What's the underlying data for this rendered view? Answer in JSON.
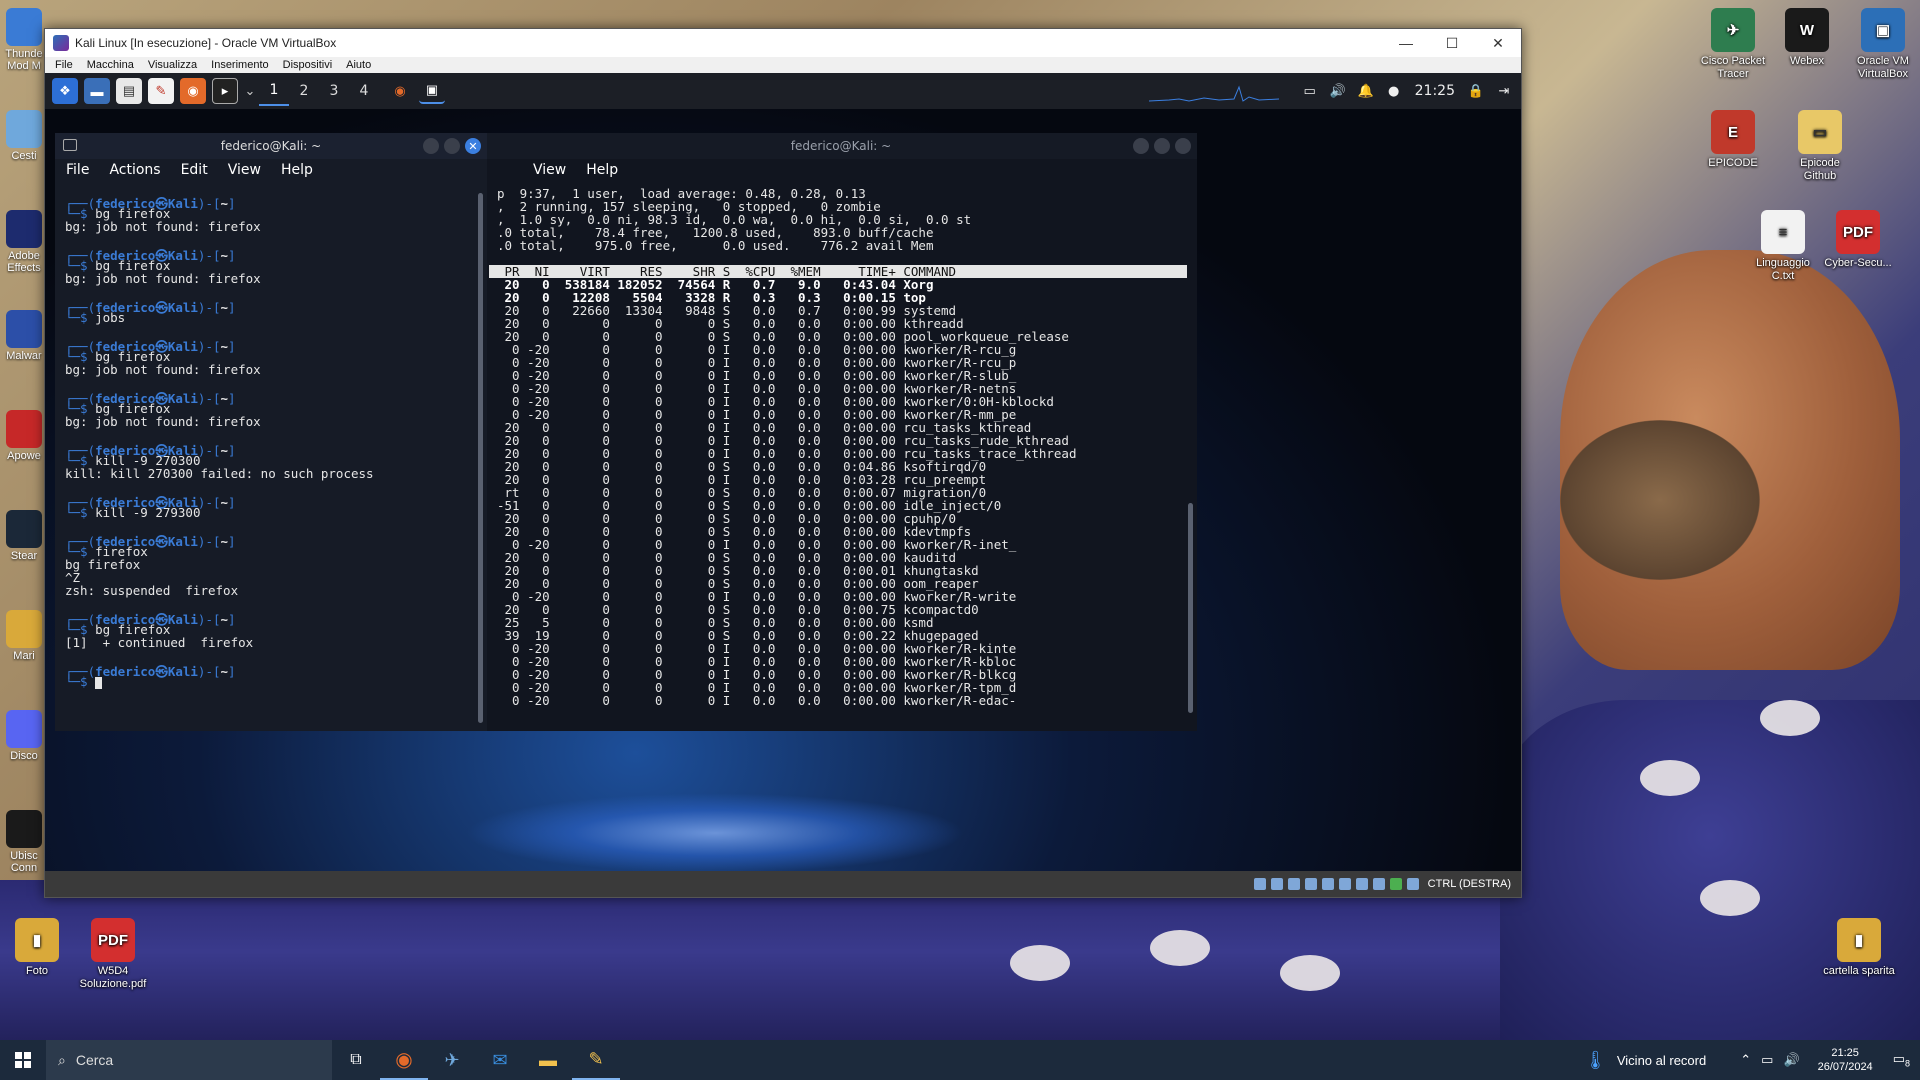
{
  "desktop": {
    "right_icons": [
      {
        "label": "Cisco Packet Tracer",
        "color": "#2e7d4f",
        "glyph": "✈"
      },
      {
        "label": "Webex",
        "color": "#1a1a1a",
        "glyph": "W"
      },
      {
        "label": "Oracle VM VirtualBox",
        "color": "#2c6fb7",
        "glyph": "▣"
      },
      {
        "label": "EPICODE",
        "color": "#c0392b",
        "glyph": "E"
      },
      {
        "label": "Epicode Github",
        "color": "#e8c867",
        "glyph": "▭"
      },
      {
        "label": "Linguaggio C.txt",
        "color": "#f2f2f2",
        "glyph": "≡"
      },
      {
        "label": "Cyber-Secu...",
        "color": "#d32f2f",
        "glyph": "PDF"
      },
      {
        "label": "cartella sparita",
        "color": "#d9a93a",
        "glyph": "▮"
      }
    ],
    "bottom_icons": [
      {
        "label": "Foto",
        "color": "#d9a93a",
        "glyph": "▮"
      },
      {
        "label": "W5D4 Soluzione.pdf",
        "color": "#d32f2f",
        "glyph": "PDF"
      }
    ],
    "left_partial_icons": [
      {
        "label": "Thunde Mod M",
        "color": "#3a7bd5"
      },
      {
        "label": "Cesti",
        "color": "#6fa8dc"
      },
      {
        "label": "Adobe Effects",
        "color": "#1d2b6e"
      },
      {
        "label": "Malwar",
        "color": "#2c4fa8"
      },
      {
        "label": "Apowe",
        "color": "#c62828"
      },
      {
        "label": "Stear",
        "color": "#1b2838"
      },
      {
        "label": "Mari",
        "color": "#d9a93a"
      },
      {
        "label": "Disco",
        "color": "#5865f2"
      },
      {
        "label": "Ubisc Conn",
        "color": "#1a1a1a"
      }
    ]
  },
  "vbox": {
    "title": "Kali Linux [In esecuzione] - Oracle VM VirtualBox",
    "menu": [
      "File",
      "Macchina",
      "Visualizza",
      "Inserimento",
      "Dispositivi",
      "Aiuto"
    ],
    "status_text": "CTRL (DESTRA)"
  },
  "kali_panel": {
    "workspaces": [
      "1",
      "2",
      "3",
      "4"
    ],
    "clock": "21:25"
  },
  "term_left": {
    "title": "federico@Kali: ~",
    "menu": [
      "File",
      "Actions",
      "Edit",
      "View",
      "Help"
    ],
    "prompt_user": "federico㉿Kali",
    "prompt_dir": "~",
    "blocks": [
      {
        "cmd": "bg firefox",
        "out": [
          "bg: job not found: firefox"
        ]
      },
      {
        "cmd": "bg firefox",
        "out": [
          "bg: job not found: firefox"
        ]
      },
      {
        "cmd": "jobs",
        "out": []
      },
      {
        "cmd": "bg firefox",
        "out": [
          "bg: job not found: firefox"
        ]
      },
      {
        "cmd": "bg firefox",
        "out": [
          "bg: job not found: firefox"
        ]
      },
      {
        "cmd": "kill -9 270300",
        "out": [
          "kill: kill 270300 failed: no such process"
        ]
      },
      {
        "cmd": "kill -9 279300",
        "out": []
      },
      {
        "cmd": "firefox",
        "out": [
          "bg firefox",
          "^Z",
          "zsh: suspended  firefox"
        ]
      },
      {
        "cmd": "bg firefox",
        "out": [
          "[1]  + continued  firefox"
        ]
      }
    ]
  },
  "term_right": {
    "title": "federico@Kali: ~",
    "menu": [
      "View",
      "Help"
    ],
    "summary": [
      "p  9:37,  1 user,  load average: 0.48, 0.28, 0.13",
      ",  2 running, 157 sleeping,   0 stopped,   0 zombie",
      ",  1.0 sy,  0.0 ni, 98.3 id,  0.0 wa,  0.0 hi,  0.0 si,  0.0 st",
      ".0 total,    78.4 free,   1200.8 used,    893.0 buff/cache",
      ".0 total,    975.0 free,      0.0 used.    776.2 avail Mem"
    ],
    "header": " PR  NI    VIRT    RES    SHR S  %CPU  %MEM     TIME+ COMMAND",
    "rows": [
      " 20   0  538184 182052  74564 R   0.7   9.0   0:43.04 Xorg",
      " 20   0   12208   5504   3328 R   0.3   0.3   0:00.15 top",
      " 20   0   22660  13304   9848 S   0.0   0.7   0:00.99 systemd",
      " 20   0       0      0      0 S   0.0   0.0   0:00.00 kthreadd",
      " 20   0       0      0      0 S   0.0   0.0   0:00.00 pool_workqueue_release",
      "  0 -20       0      0      0 I   0.0   0.0   0:00.00 kworker/R-rcu_g",
      "  0 -20       0      0      0 I   0.0   0.0   0:00.00 kworker/R-rcu_p",
      "  0 -20       0      0      0 I   0.0   0.0   0:00.00 kworker/R-slub_",
      "  0 -20       0      0      0 I   0.0   0.0   0:00.00 kworker/R-netns",
      "  0 -20       0      0      0 I   0.0   0.0   0:00.00 kworker/0:0H-kblockd",
      "  0 -20       0      0      0 I   0.0   0.0   0:00.00 kworker/R-mm_pe",
      " 20   0       0      0      0 I   0.0   0.0   0:00.00 rcu_tasks_kthread",
      " 20   0       0      0      0 I   0.0   0.0   0:00.00 rcu_tasks_rude_kthread",
      " 20   0       0      0      0 I   0.0   0.0   0:00.00 rcu_tasks_trace_kthread",
      " 20   0       0      0      0 S   0.0   0.0   0:04.86 ksoftirqd/0",
      " 20   0       0      0      0 I   0.0   0.0   0:03.28 rcu_preempt",
      " rt   0       0      0      0 S   0.0   0.0   0:00.07 migration/0",
      "-51   0       0      0      0 S   0.0   0.0   0:00.00 idle_inject/0",
      " 20   0       0      0      0 S   0.0   0.0   0:00.00 cpuhp/0",
      " 20   0       0      0      0 S   0.0   0.0   0:00.00 kdevtmpfs",
      "  0 -20       0      0      0 I   0.0   0.0   0:00.00 kworker/R-inet_",
      " 20   0       0      0      0 S   0.0   0.0   0:00.00 kauditd",
      " 20   0       0      0      0 S   0.0   0.0   0:00.01 khungtaskd",
      " 20   0       0      0      0 S   0.0   0.0   0:00.00 oom_reaper",
      "  0 -20       0      0      0 I   0.0   0.0   0:00.00 kworker/R-write",
      " 20   0       0      0      0 S   0.0   0.0   0:00.75 kcompactd0",
      " 25   5       0      0      0 S   0.0   0.0   0:00.00 ksmd",
      " 39  19       0      0      0 S   0.0   0.0   0:00.22 khugepaged",
      "  0 -20       0      0      0 I   0.0   0.0   0:00.00 kworker/R-kinte",
      "  0 -20       0      0      0 I   0.0   0.0   0:00.00 kworker/R-kbloc",
      "  0 -20       0      0      0 I   0.0   0.0   0:00.00 kworker/R-blkcg",
      "  0 -20       0      0      0 I   0.0   0.0   0:00.00 kworker/R-tpm_d",
      "  0 -20       0      0      0 I   0.0   0.0   0:00.00 kworker/R-edac-"
    ]
  },
  "taskbar": {
    "search_placeholder": "Cerca",
    "weather": "Vicino al record",
    "time": "21:25",
    "date": "26/07/2024",
    "notif_count": "8"
  }
}
